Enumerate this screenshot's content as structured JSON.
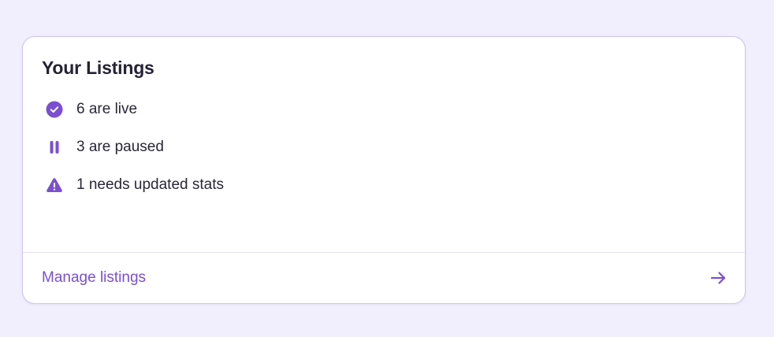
{
  "card": {
    "title": "Your Listings",
    "items": [
      {
        "icon": "check-circle-icon",
        "text": "6 are live"
      },
      {
        "icon": "pause-icon",
        "text": "3 are paused"
      },
      {
        "icon": "warning-triangle-icon",
        "text": "1 needs updated stats"
      }
    ],
    "footer": {
      "link_label": "Manage listings",
      "icon": "arrow-right-icon"
    }
  },
  "colors": {
    "page_background": "#f1eefd",
    "card_background": "#ffffff",
    "accent": "#7b4fd0",
    "text": "#2a2738"
  }
}
